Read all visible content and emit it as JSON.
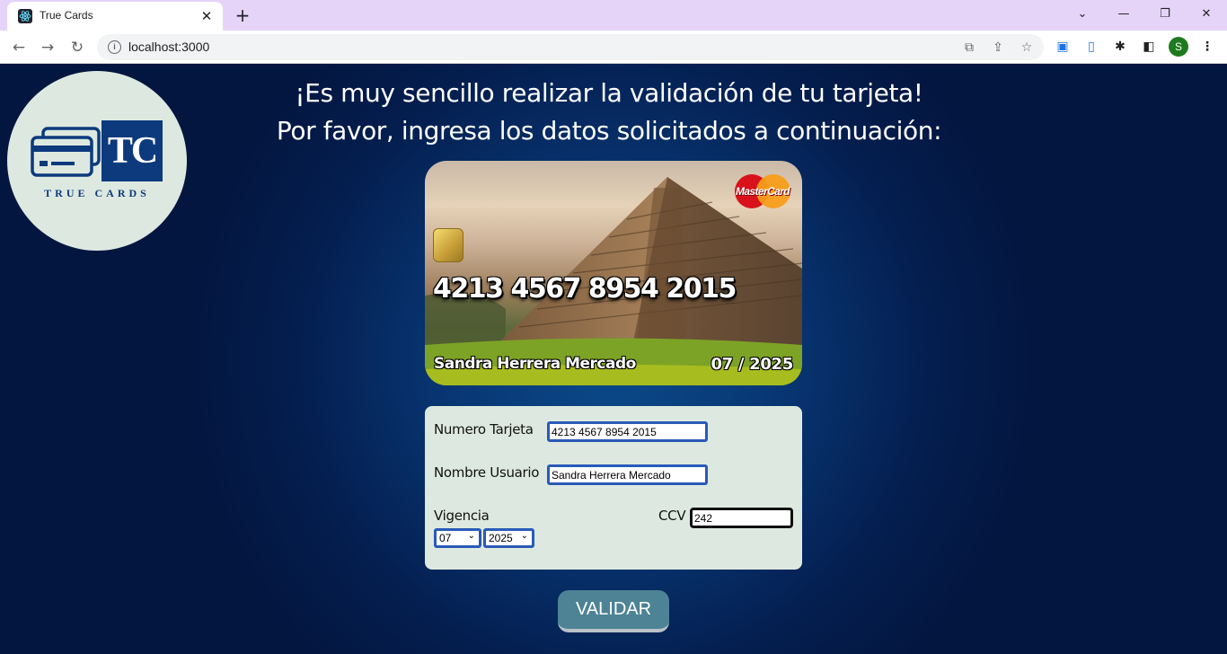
{
  "browser": {
    "tab_title": "True Cards",
    "tab_close": "✕",
    "new_tab": "+",
    "url": "localhost:3000",
    "profile_initial": "S",
    "window_controls": {
      "menu": "⌄",
      "minimize": "—",
      "restore": "❐",
      "close": "✕"
    },
    "nav": {
      "back": "←",
      "forward": "→",
      "reload": "↻"
    }
  },
  "logo": {
    "monogram": "TC",
    "brand": "TRUE CARDS"
  },
  "heading": {
    "line1": "¡Es muy sencillo realizar la validación de tu tarjeta!",
    "line2": "Por favor, ingresa los datos solicitados a continuación:"
  },
  "card": {
    "brand": "MasterCard",
    "number": "4213 4567 8954 2015",
    "holder": "Sandra Herrera Mercado",
    "expiry": "07 / 2025"
  },
  "form": {
    "number_label": "Numero Tarjeta",
    "number_value": "4213 4567 8954 2015",
    "user_label": "Nombre Usuario",
    "user_value": "Sandra Herrera Mercado",
    "validity_label": "Vigencia",
    "month_value": "07",
    "year_value": "2025",
    "ccv_label": "CCV",
    "ccv_value": "242"
  },
  "validate_label": "VALIDAR",
  "colors": {
    "form_bg": "#dde9e0",
    "input_border": "#2a5ab8",
    "button_bg": "#4d8395",
    "page_bg": "#083673",
    "tab_strip": "#e5d4f7"
  }
}
